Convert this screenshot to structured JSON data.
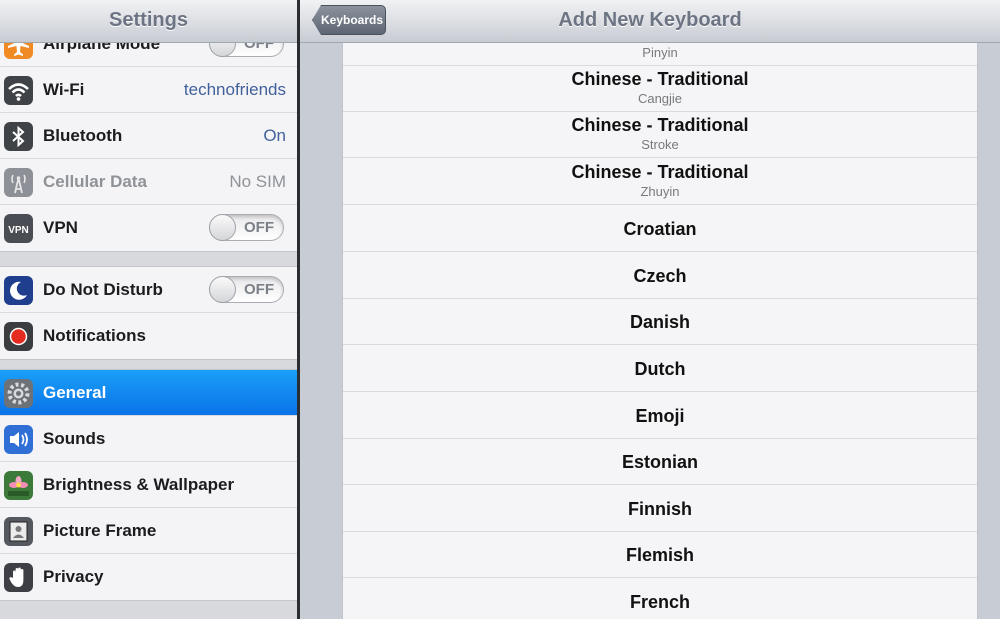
{
  "sidebar": {
    "title": "Settings",
    "group1": [
      {
        "label": "Airplane Mode",
        "toggle": "OFF"
      },
      {
        "label": "Wi-Fi",
        "value": "technofriends"
      },
      {
        "label": "Bluetooth",
        "value": "On"
      },
      {
        "label": "Cellular Data",
        "value": "No SIM"
      },
      {
        "label": "VPN",
        "toggle": "OFF"
      }
    ],
    "group2": [
      {
        "label": "Do Not Disturb",
        "toggle": "OFF"
      },
      {
        "label": "Notifications"
      }
    ],
    "group3": [
      {
        "label": "General"
      },
      {
        "label": "Sounds"
      },
      {
        "label": "Brightness & Wallpaper"
      },
      {
        "label": "Picture Frame"
      },
      {
        "label": "Privacy"
      }
    ]
  },
  "header": {
    "back_label": "Keyboards",
    "title": "Add New Keyboard"
  },
  "keyboards": [
    {
      "name": "",
      "sub": "Pinyin"
    },
    {
      "name": "Chinese - Traditional",
      "sub": "Cangjie"
    },
    {
      "name": "Chinese - Traditional",
      "sub": "Stroke"
    },
    {
      "name": "Chinese - Traditional",
      "sub": "Zhuyin"
    },
    {
      "name": "Croatian"
    },
    {
      "name": "Czech"
    },
    {
      "name": "Danish"
    },
    {
      "name": "Dutch"
    },
    {
      "name": "Emoji"
    },
    {
      "name": "Estonian"
    },
    {
      "name": "Finnish"
    },
    {
      "name": "Flemish"
    },
    {
      "name": "French"
    }
  ],
  "colors": {
    "selected": "#0a84ff",
    "value_text": "#41619c"
  }
}
